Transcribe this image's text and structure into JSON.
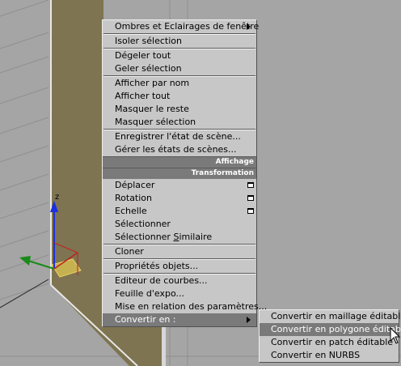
{
  "menu": {
    "items": [
      {
        "label": "Ombres et Eclairages de fenêtre",
        "submenu": true
      },
      {
        "label": "Isoler sélection"
      },
      {
        "label": "Dégeler tout"
      },
      {
        "label": "Geler sélection"
      },
      {
        "label": "Afficher par nom"
      },
      {
        "label": "Afficher tout"
      },
      {
        "label": "Masquer le reste"
      },
      {
        "label": "Masquer sélection"
      },
      {
        "label": "Enregistrer l'état de scène..."
      },
      {
        "label": "Gérer les états de scènes..."
      }
    ],
    "headers": {
      "display": "Affichage",
      "transform": "Transformation"
    },
    "transform_items": [
      {
        "label": "Déplacer",
        "has_settings_box": true
      },
      {
        "label": "Rotation",
        "has_settings_box": true
      },
      {
        "label": "Echelle",
        "has_settings_box": true
      },
      {
        "label": "Sélectionner"
      },
      {
        "label": "Sélectionner Similaire",
        "underlined_part": "S"
      },
      {
        "label": "Cloner"
      },
      {
        "label": "Propriétés objets..."
      },
      {
        "label": "Editeur de courbes..."
      },
      {
        "label": "Feuille d'expo..."
      },
      {
        "label": "Mise en relation des paramètres..."
      },
      {
        "label": "Convertir en :",
        "submenu": true,
        "selected": true
      }
    ],
    "similaire": {
      "prefix": "Sélectionner ",
      "underlined": "S",
      "rest": "imilaire"
    }
  },
  "submenu": {
    "items": [
      {
        "label": "Convertir en maillage éditable"
      },
      {
        "label": "Convertir en polygone éditable",
        "selected": true
      },
      {
        "label": "Convertir en patch éditable"
      },
      {
        "label": "Convertir en NURBS"
      }
    ]
  },
  "gizmo": {
    "axis_label": "z"
  },
  "colors": {
    "menu_bg": "#c7c7c7",
    "highlight": "#7a7a7a",
    "viewport_bg": "#a5a5a5",
    "object": "#7e7451"
  }
}
